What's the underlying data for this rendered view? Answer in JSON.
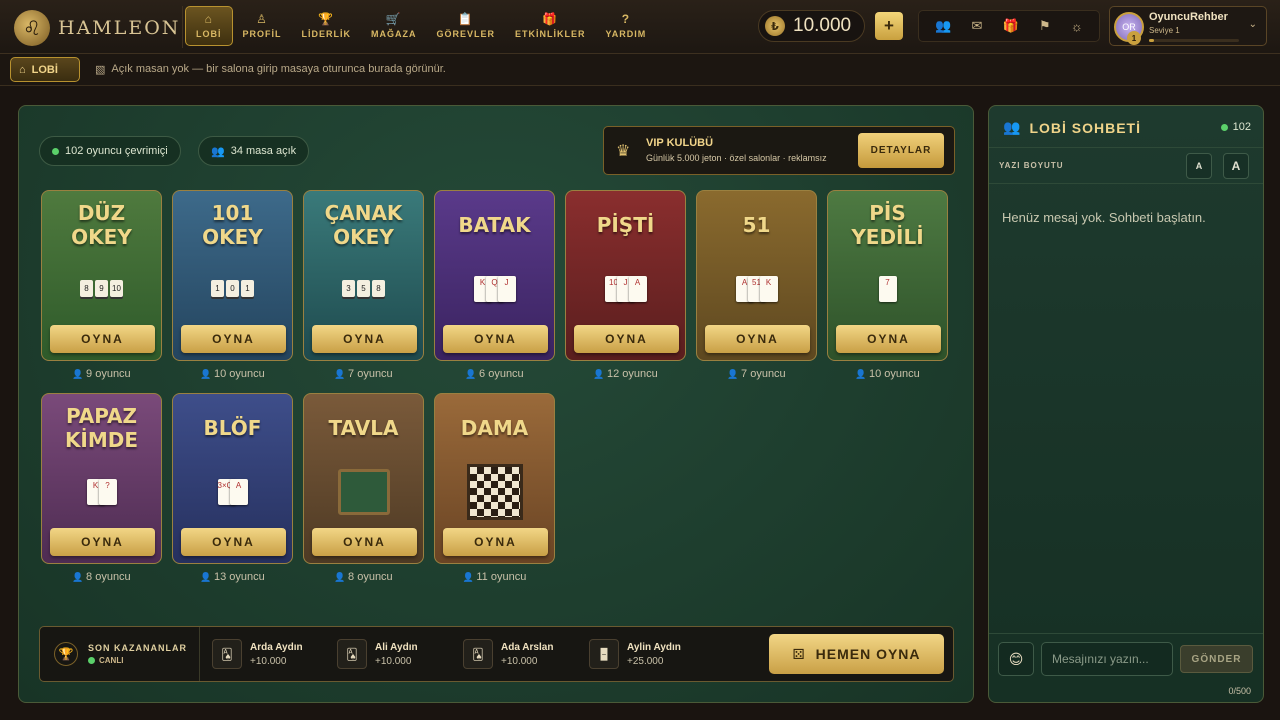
{
  "brand": {
    "name": "HAMLEON",
    "mark": "♌"
  },
  "nav": [
    {
      "label": "LOBİ",
      "icon": "home-icon",
      "glyph": "⌂"
    },
    {
      "label": "PROFİL",
      "icon": "user-icon",
      "glyph": "♙"
    },
    {
      "label": "LİDERLİK",
      "icon": "trophy-icon",
      "glyph": "🏆"
    },
    {
      "label": "MAĞAZA",
      "icon": "cart-icon",
      "glyph": "🛒"
    },
    {
      "label": "GÖREVLER",
      "icon": "clipboard-icon",
      "glyph": "📋"
    },
    {
      "label": "ETKİNLİKLER",
      "icon": "gift-icon",
      "glyph": "🎁"
    },
    {
      "label": "YARDIM",
      "icon": "help-icon",
      "glyph": "?"
    }
  ],
  "balance": {
    "value": "10.000",
    "plus": "+"
  },
  "top_icons": [
    {
      "name": "friends-icon",
      "glyph": "👥"
    },
    {
      "name": "mail-icon",
      "glyph": "✉"
    },
    {
      "name": "gift-icon",
      "glyph": "🎁"
    },
    {
      "name": "flag-icon",
      "glyph": "⚑"
    },
    {
      "name": "settings-icon",
      "glyph": "☼"
    }
  ],
  "user": {
    "name": "OyuncuRehber",
    "level": "Seviye 1",
    "initials": "OR",
    "level_num": "1",
    "xp_fraction": 0.05
  },
  "subbar": {
    "pill": "LOBİ",
    "message": "Açık masan yok — bir salona girip masaya oturunca burada görünür."
  },
  "stats": {
    "online": "102 oyuncu çevrimiçi",
    "tables": "34 masa açık"
  },
  "vip": {
    "title": "VIP KULÜBÜ",
    "subtitle": "Günlük 5.000 jeton · özel salonlar · reklamsız",
    "button": "DETAYLAR"
  },
  "games": [
    {
      "title": "DÜZ\nOKEY",
      "players": "9 oyuncu",
      "button": "OYNA",
      "bg": "#4f7a3e",
      "bg2": "#2e5a2a",
      "art": "tiles",
      "art_text": [
        "8",
        "9",
        "10"
      ]
    },
    {
      "title": "101\nOKEY",
      "players": "10 oyuncu",
      "button": "OYNA",
      "bg": "#3d6a8a",
      "bg2": "#24445e",
      "art": "tiles",
      "art_text": [
        "1",
        "0",
        "1"
      ]
    },
    {
      "title": "ÇANAK\nOKEY",
      "players": "7 oyuncu",
      "button": "OYNA",
      "bg": "#3a7a7a",
      "bg2": "#1e4a4e",
      "art": "tiles",
      "art_text": [
        "3",
        "5",
        "8"
      ]
    },
    {
      "title": "BATAK",
      "players": "6 oyuncu",
      "button": "OYNA",
      "bg": "#5a3a8a",
      "bg2": "#3a2360",
      "art": "cards",
      "art_text": [
        "K",
        "Q",
        "J"
      ]
    },
    {
      "title": "PİŞTİ",
      "players": "12 oyuncu",
      "button": "OYNA",
      "bg": "#8a2e2e",
      "bg2": "#5a1e1e",
      "art": "cards",
      "art_text": [
        "10",
        "J",
        "A"
      ]
    },
    {
      "title": "51",
      "players": "7 oyuncu",
      "button": "OYNA",
      "bg": "#8a6a2e",
      "bg2": "#5e4820",
      "art": "cards",
      "art_text": [
        "A",
        "51",
        "K"
      ]
    },
    {
      "title": "PİS\nYEDİLİ",
      "players": "10 oyuncu",
      "button": "OYNA",
      "bg": "#4e7a42",
      "bg2": "#2e522a",
      "art": "cards",
      "art_text": [
        "7"
      ]
    },
    {
      "title": "PAPAZ\nKİMDE",
      "players": "8 oyuncu",
      "button": "OYNA",
      "bg": "#7a4a7a",
      "bg2": "#4e2c52",
      "art": "cards",
      "art_text": [
        "K",
        "?"
      ]
    },
    {
      "title": "BLÖF",
      "players": "13 oyuncu",
      "button": "OYNA",
      "bg": "#3e4e8a",
      "bg2": "#26305e",
      "art": "cards",
      "art_text": [
        "3×Q?",
        "A"
      ]
    },
    {
      "title": "TAVLA",
      "players": "8 oyuncu",
      "button": "OYNA",
      "bg": "#7a5a3a",
      "bg2": "#4e3a24",
      "art": "board",
      "art_text": []
    },
    {
      "title": "DAMA",
      "players": "11 oyuncu",
      "button": "OYNA",
      "bg": "#9a6a3a",
      "bg2": "#6a4424",
      "art": "checker",
      "art_text": []
    }
  ],
  "winners": {
    "label": "SON KAZANANLAR",
    "live": "CANLI",
    "items": [
      {
        "name": "Arda Aydın",
        "amount": "+10.000",
        "glyph": "🂡"
      },
      {
        "name": "Ali Aydın",
        "amount": "+10.000",
        "glyph": "🂡"
      },
      {
        "name": "Ada Arslan",
        "amount": "+10.000",
        "glyph": "🂡"
      },
      {
        "name": "Aylin Aydın",
        "amount": "+25.000",
        "glyph": "🁢"
      }
    ],
    "play_now": "HEMEN OYNA"
  },
  "chat": {
    "title": "LOBİ SOHBETİ",
    "count": "102",
    "font_label": "YAZI BOYUTU",
    "font_small": "A",
    "font_large": "A",
    "empty": "Henüz mesaj yok. Sohbeti başlatın.",
    "placeholder": "Mesajınızı yazın...",
    "send": "GÖNDER",
    "counter": "0/500"
  }
}
